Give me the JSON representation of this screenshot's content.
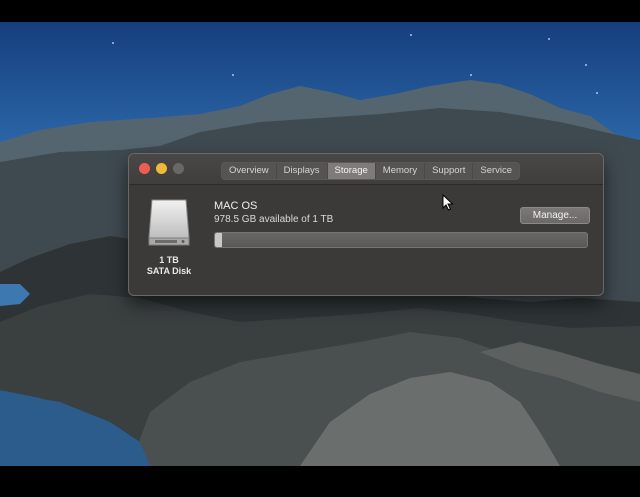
{
  "window": {
    "tabs": [
      "Overview",
      "Displays",
      "Storage",
      "Memory",
      "Support",
      "Service"
    ],
    "active_tab": "Storage"
  },
  "disk": {
    "capacity_label": "1 TB",
    "type_label": "SATA Disk"
  },
  "volume": {
    "name": "MAC OS",
    "available_text": "978.5 GB available of 1 TB",
    "used_fraction": 0.02
  },
  "buttons": {
    "manage_label": "Manage..."
  },
  "colors": {
    "close": "#ee5d50",
    "minimize": "#f1b93a",
    "zoom_disabled": "#6a6866",
    "window_bg": "#3c3a39"
  }
}
